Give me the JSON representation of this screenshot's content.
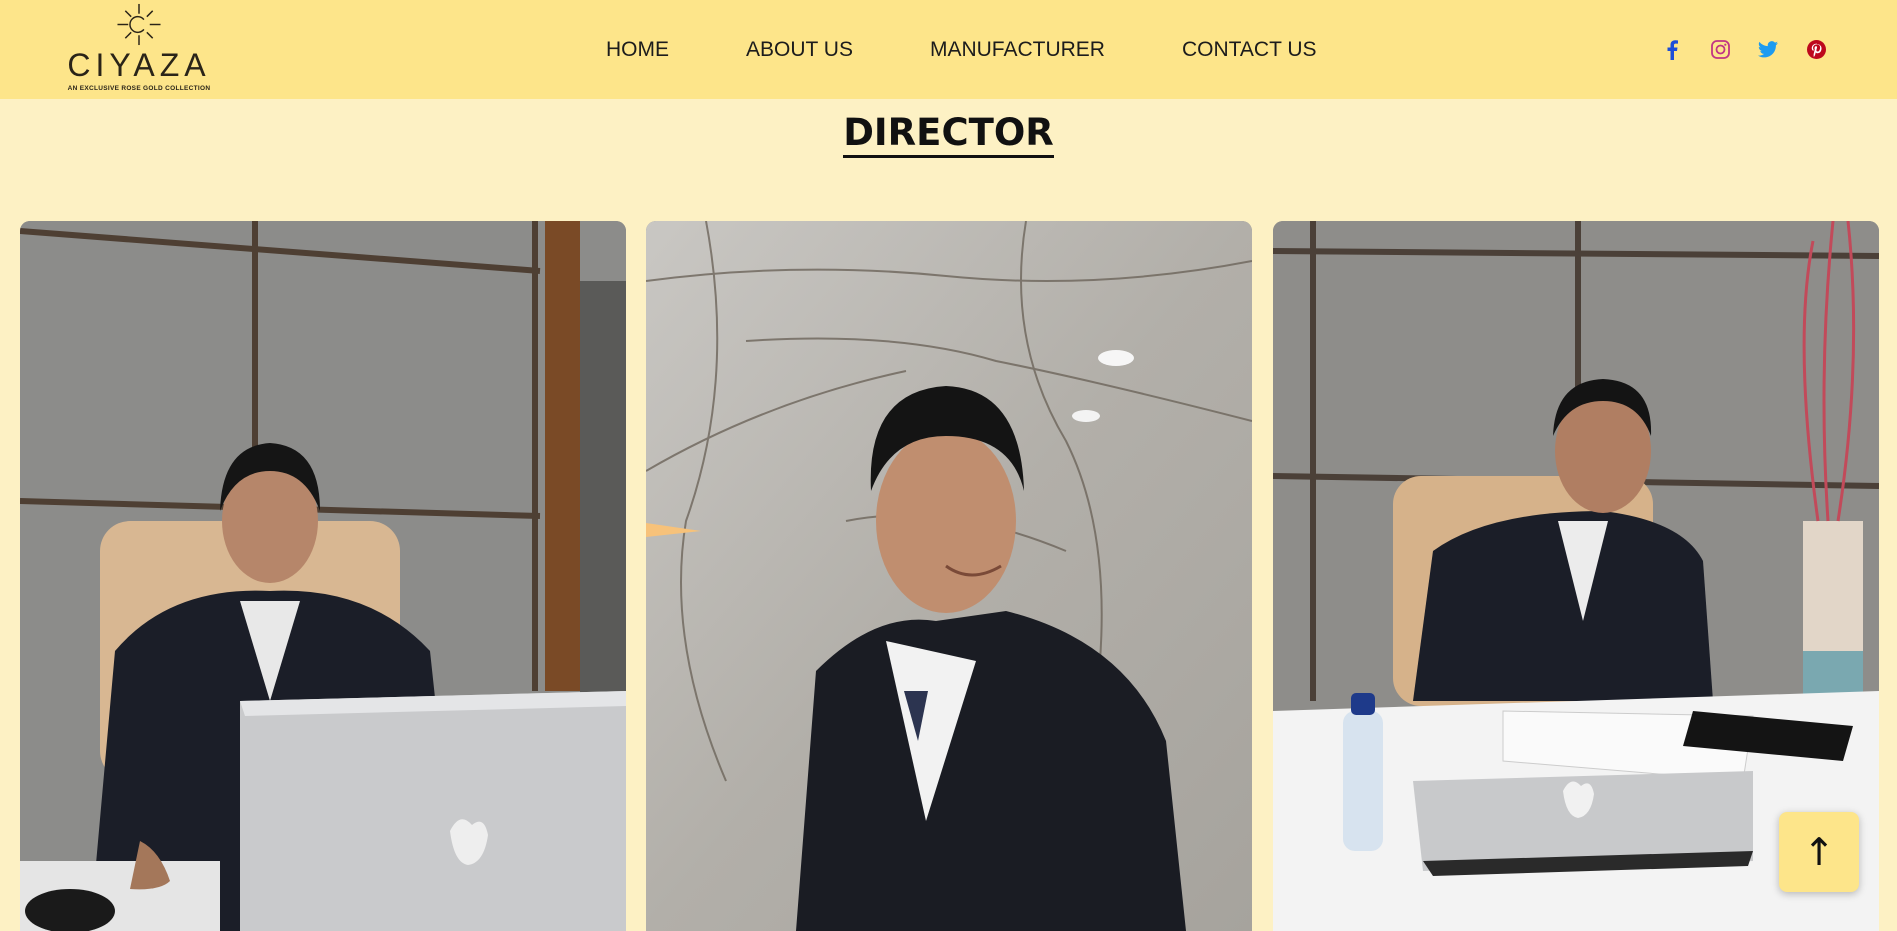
{
  "brand": {
    "name": "CIYAZA",
    "tagline": "AN EXCLUSIVE ROSE GOLD COLLECTION"
  },
  "nav": {
    "items": [
      "HOME",
      "ABOUT US",
      "MANUFACTURER",
      "CONTACT US"
    ]
  },
  "social": {
    "icons": [
      "facebook-icon",
      "instagram-icon",
      "twitter-icon",
      "pinterest-icon"
    ],
    "colors": {
      "facebook": "#1d4ed8",
      "instagram": "#c13584",
      "twitter": "#1d9bf0",
      "pinterest": "#bd081c"
    }
  },
  "section": {
    "title": "DIRECTOR"
  },
  "directors": [
    {
      "photo": "director-photo-1"
    },
    {
      "photo": "director-photo-2"
    },
    {
      "photo": "director-photo-3"
    }
  ],
  "scroll_top": {
    "label": "↑"
  },
  "colors": {
    "header_bg": "#fde58a",
    "page_bg": "#fdf1c4",
    "text": "#111111"
  }
}
